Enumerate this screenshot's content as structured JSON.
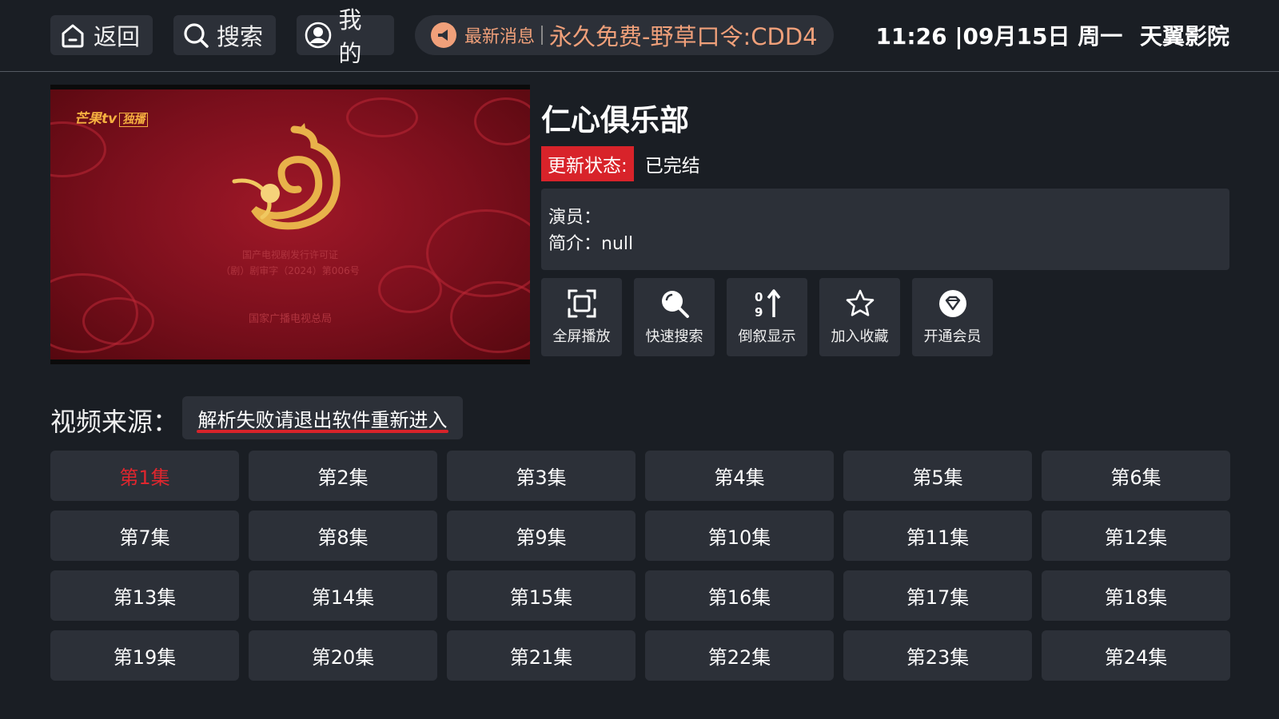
{
  "nav": {
    "back_label": "返回",
    "search_label": "搜索",
    "mine_label": "我的"
  },
  "news": {
    "tag": "最新消息",
    "message": "永久免费-野草口令:CDD4"
  },
  "status_bar": {
    "time": "11:26 |09月15日 周一",
    "app_name": "天翼影院"
  },
  "poster": {
    "logo_text": "芒果tv",
    "logo_badge": "独播",
    "license_line1": "国产电视剧发行许可证",
    "license_line2": "（剧）剧审字（2024）第006号",
    "issuer": "国家广播电视总局"
  },
  "detail": {
    "title": "仁心俱乐部",
    "status_label": "更新状态:",
    "status_value": "已完结",
    "actors_line": "演员：",
    "intro_line": "简介：null"
  },
  "actions": [
    {
      "label": "全屏播放",
      "icon": "fullscreen-icon"
    },
    {
      "label": "快速搜索",
      "icon": "search-icon"
    },
    {
      "label": "倒叙显示",
      "icon": "sort-icon"
    },
    {
      "label": "加入收藏",
      "icon": "star-icon"
    },
    {
      "label": "开通会员",
      "icon": "diamond-icon"
    }
  ],
  "source": {
    "label": "视频来源：",
    "value": "解析失败请退出软件重新进入"
  },
  "episodes": [
    "第1集",
    "第2集",
    "第3集",
    "第4集",
    "第5集",
    "第6集",
    "第7集",
    "第8集",
    "第9集",
    "第10集",
    "第11集",
    "第12集",
    "第13集",
    "第14集",
    "第15集",
    "第16集",
    "第17集",
    "第18集",
    "第19集",
    "第20集",
    "第21集",
    "第22集",
    "第23集",
    "第24集"
  ],
  "active_episode": 0,
  "colors": {
    "background": "#1a1e24",
    "panel": "#2c3038",
    "accent_red": "#d8232a",
    "news_orange": "#f0a07a"
  }
}
